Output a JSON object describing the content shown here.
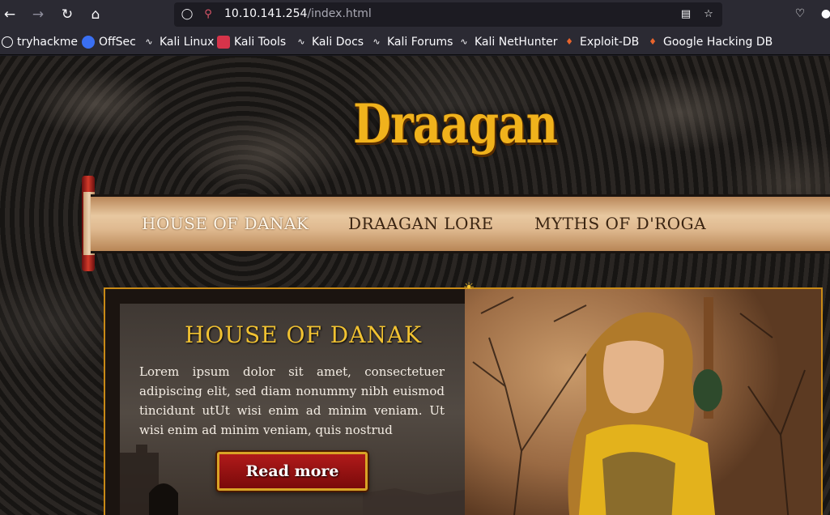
{
  "browser": {
    "url_host": "10.10.141.254",
    "url_path": "/index.html",
    "bookmarks": [
      {
        "label": "tryhackme",
        "icon": "globe-icon"
      },
      {
        "label": "OffSec",
        "icon": "offsec-icon"
      },
      {
        "label": "Kali Linux",
        "icon": "kali-dragon-icon"
      },
      {
        "label": "Kali Tools",
        "icon": "kali-tools-icon"
      },
      {
        "label": "Kali Docs",
        "icon": "kali-dragon-icon"
      },
      {
        "label": "Kali Forums",
        "icon": "kali-dragon-icon"
      },
      {
        "label": "Kali NetHunter",
        "icon": "kali-dragon-icon"
      },
      {
        "label": "Exploit-DB",
        "icon": "exploitdb-icon"
      },
      {
        "label": "Google Hacking DB",
        "icon": "exploitdb-icon"
      }
    ]
  },
  "site": {
    "logo": "Draagan",
    "menu": [
      "HOUSE OF DANAK",
      "DRAAGAN LORE",
      "MYTHS OF D'ROGA"
    ],
    "active_menu": "HOUSE OF DANAK"
  },
  "content": {
    "title": "HOUSE OF DANAK",
    "body": "Lorem ipsum dolor sit amet, consectetuer adipiscing elit, sed diam nonummy nibh euismod tincidunt utUt wisi enim ad minim veniam. Ut wisi enim ad minim veniam, quis nostrud",
    "read_more": "Read more"
  },
  "colors": {
    "accent_gold": "#f1c232",
    "button_red": "#b01a1a",
    "frame_gold": "#c98a16"
  }
}
